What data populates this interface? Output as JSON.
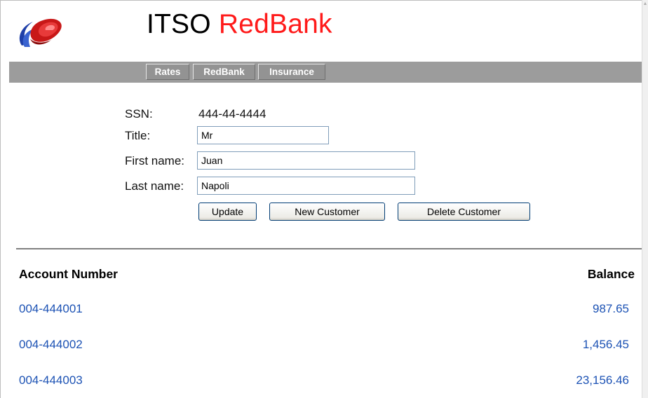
{
  "header": {
    "logo_icon": "itso-swirl-logo",
    "title_part1": "ITSO",
    "title_part2": "RedBank",
    "accent_color": "#ff1a1a"
  },
  "nav": {
    "tabs": [
      "Rates",
      "RedBank",
      "Insurance"
    ]
  },
  "form": {
    "ssn_label": "SSN:",
    "ssn_value": "444-44-4444",
    "title_label": "Title:",
    "title_value": "Mr",
    "first_name_label": "First name:",
    "first_name_value": "Juan",
    "last_name_label": "Last name:",
    "last_name_value": "Napoli"
  },
  "buttons": {
    "update": "Update",
    "new_customer": "New Customer",
    "delete_customer": "Delete Customer"
  },
  "accounts": {
    "headers": {
      "number": "Account Number",
      "balance": "Balance"
    },
    "rows": [
      {
        "number": "004-444001",
        "balance": "987.65"
      },
      {
        "number": "004-444002",
        "balance": "1,456.45"
      },
      {
        "number": "004-444003",
        "balance": "23,156.46"
      }
    ],
    "link_color": "#1c52b4"
  }
}
